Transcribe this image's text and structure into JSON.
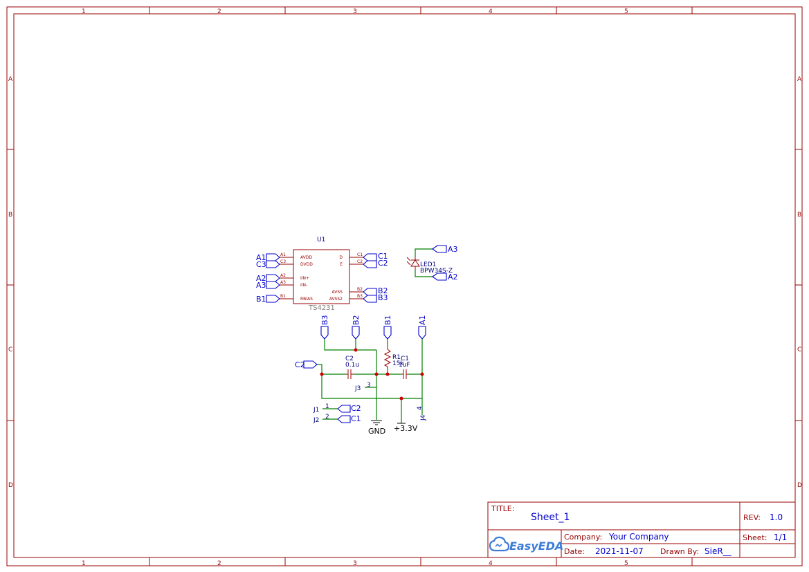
{
  "sheet": {
    "zones_x": [
      "1",
      "2",
      "3",
      "4",
      "5"
    ],
    "zones_y": [
      "A",
      "B",
      "C",
      "D"
    ]
  },
  "u1": {
    "designator": "U1",
    "part": "TS4231",
    "left_pins": [
      "A1",
      "C3",
      "A2",
      "A3",
      "B1"
    ],
    "left_names": [
      "AVDD",
      "DVDD",
      "IIN+",
      "IIN-",
      "RBIAS"
    ],
    "right_pins": [
      "C1",
      "C2",
      "B2",
      "B3"
    ],
    "right_names": [
      "D",
      "E",
      "AVSS",
      "AVSS2"
    ],
    "left_nets": [
      "A1",
      "C3",
      "A2",
      "A3",
      "B1"
    ],
    "right_nets": [
      "C1",
      "C2",
      "B2",
      "B3"
    ]
  },
  "led1": {
    "designator": "LED1",
    "value": "BPW34S-Z",
    "net_top": "A3",
    "net_bottom": "A2"
  },
  "lower": {
    "top_nets": [
      "B3",
      "B2",
      "B1",
      "A1"
    ],
    "c2_flag": "C2",
    "c2": {
      "designator": "C2",
      "value": "0.1u"
    },
    "r1": {
      "designator": "R1",
      "value": "15k"
    },
    "c1": {
      "designator": "C1",
      "value": "1uF"
    },
    "j3": {
      "designator": "J3",
      "pin": "3"
    },
    "j1": {
      "designator": "J1",
      "pin": "1",
      "net": "C2"
    },
    "j2": {
      "designator": "J2",
      "pin": "2",
      "net": "C1"
    },
    "j4": {
      "designator": "J4",
      "pin": "4"
    },
    "gnd": "GND",
    "vcc": "+3.3V"
  },
  "title_block": {
    "title_label": "TITLE:",
    "title": "Sheet_1",
    "rev_label": "REV:",
    "rev": "1.0",
    "company_label": "Company:",
    "company": "Your Company",
    "sheet_label": "Sheet:",
    "sheet": "1/1",
    "date_label": "Date:",
    "date": "2021-11-07",
    "drawn_label": "Drawn By:",
    "drawn_by": "SieR__",
    "logo": "EasyEDA"
  }
}
